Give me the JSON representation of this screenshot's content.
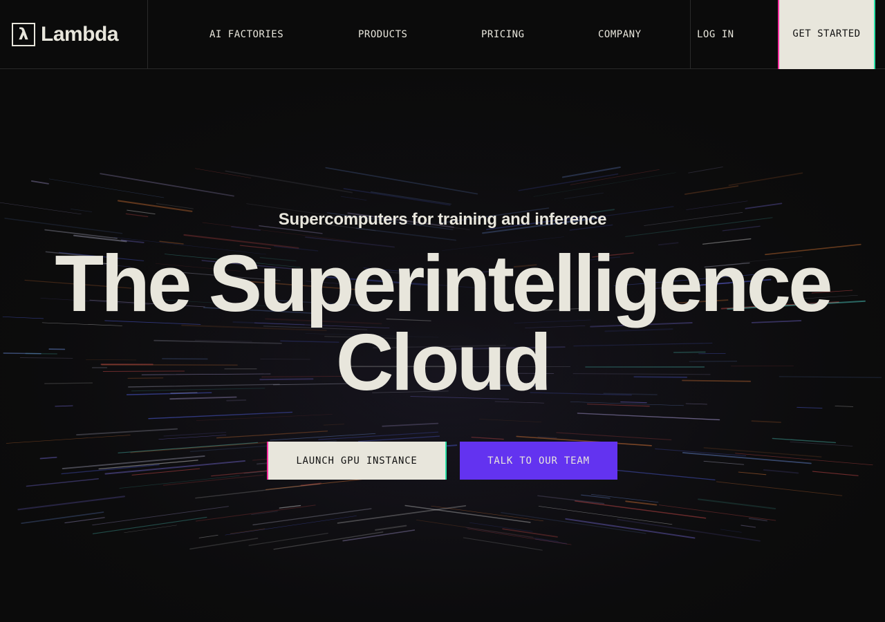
{
  "brand": {
    "name": "Lambda",
    "logo_glyph": "λ"
  },
  "nav": {
    "links": [
      {
        "label": "AI FACTORIES"
      },
      {
        "label": "PRODUCTS"
      },
      {
        "label": "PRICING"
      },
      {
        "label": "COMPANY"
      }
    ],
    "login_label": "LOG IN",
    "cta_label": "GET STARTED"
  },
  "hero": {
    "subtitle": "Supercomputers for training and inference",
    "headline_line1": "The Superintelligence",
    "headline_line2": "Cloud",
    "primary_button": "LAUNCH GPU INSTANCE",
    "secondary_button": "TALK TO OUR TEAM"
  },
  "colors": {
    "background": "#0b0b0b",
    "text": "#e8e6dc",
    "accent_purple": "#6333f0",
    "accent_pink": "#ff2fa3",
    "accent_green": "#29e3a8"
  }
}
